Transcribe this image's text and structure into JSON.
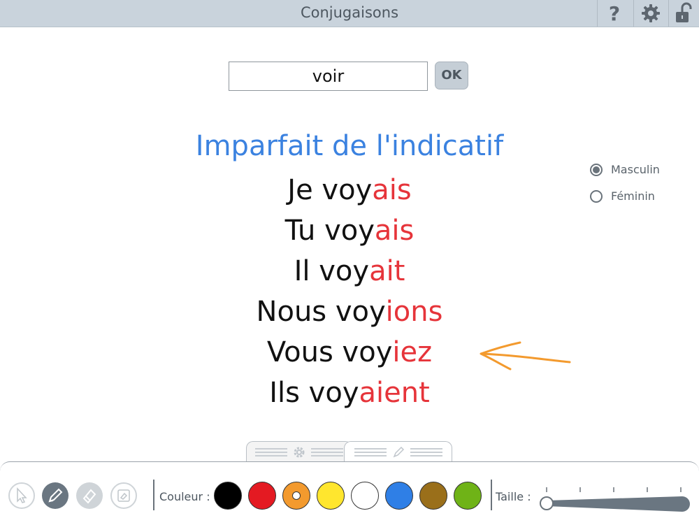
{
  "app": {
    "title": "Conjugaisons"
  },
  "header": {
    "help_icon": "help-icon",
    "settings_icon": "gear-icon",
    "lock_icon": "unlock-icon"
  },
  "search": {
    "value": "voir",
    "ok_label": "OK"
  },
  "conjugation": {
    "tense": "Imparfait de l'indicatif",
    "lines": [
      {
        "stem": "Je voy",
        "ending": "ais"
      },
      {
        "stem": "Tu voy",
        "ending": "ais"
      },
      {
        "stem": "Il voy",
        "ending": "ait"
      },
      {
        "stem": "Nous voy",
        "ending": "ions"
      },
      {
        "stem": "Vous voy",
        "ending": "iez"
      },
      {
        "stem": "Ils voy",
        "ending": "aient"
      }
    ]
  },
  "gender": {
    "options": [
      {
        "label": "Masculin",
        "selected": true
      },
      {
        "label": "Féminin",
        "selected": false
      }
    ]
  },
  "annotation": {
    "type": "arrow",
    "color": "#f39a2e"
  },
  "toolbar": {
    "tabs": [
      "settings-tab",
      "drawing-tab"
    ],
    "color_label": "Couleur :",
    "size_label": "Taille :",
    "tools": [
      "pointer-icon",
      "pencil-icon",
      "eraser-icon",
      "clear-icon"
    ],
    "active_tool": "pencil-icon",
    "colors": [
      "#000000",
      "#e41a22",
      "#f39a2e",
      "#ffe62e",
      "#ffffff",
      "#2f7fe6",
      "#9a6f1a",
      "#6fb317"
    ],
    "selected_color": "#f39a2e",
    "size_level": 0
  }
}
